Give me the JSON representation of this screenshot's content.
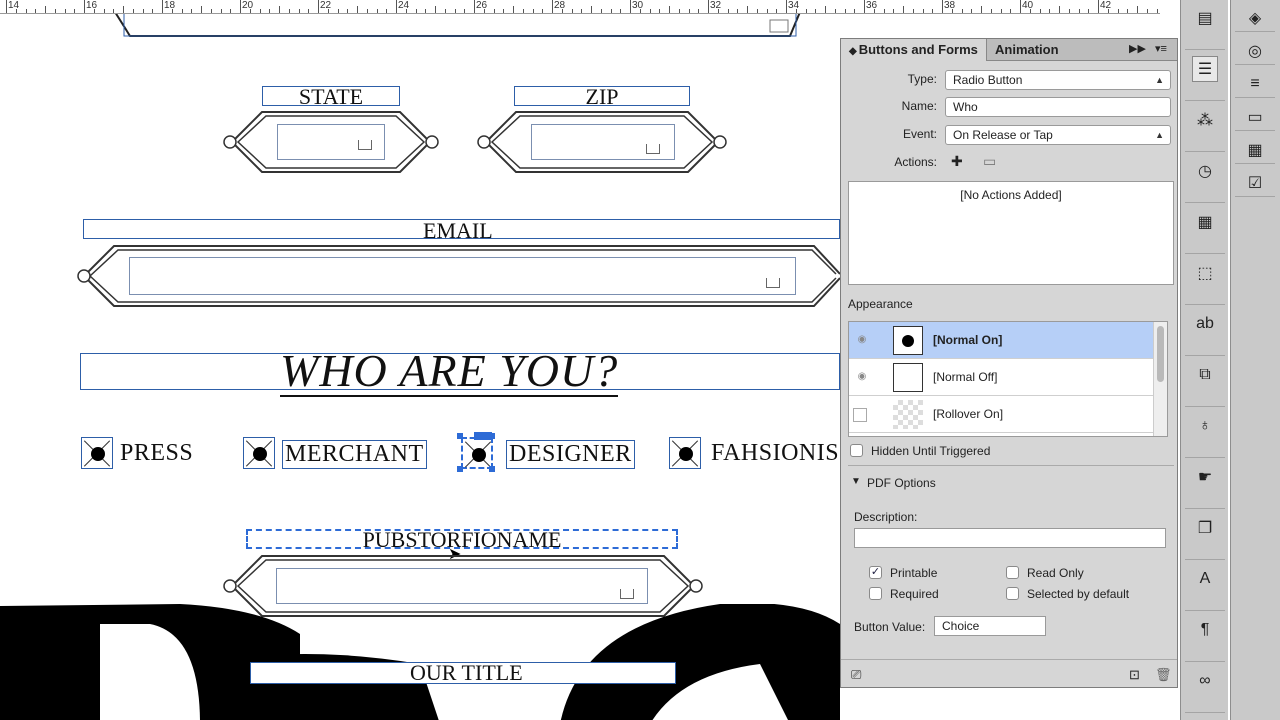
{
  "ruler": {
    "labels": [
      "14",
      "16",
      "18",
      "20",
      "22",
      "24",
      "26",
      "28",
      "30",
      "32",
      "34",
      "36",
      "38",
      "40",
      "42"
    ]
  },
  "doc": {
    "state_label": "STATE",
    "zip_label": "ZIP",
    "email_label": "EMAIL",
    "heading": "WHO ARE YOU?",
    "radios": [
      "PRESS",
      "MERCHANT",
      "DESIGNER",
      "FAHSIONIS"
    ],
    "overlap_label": "PUBSTORFIONAME",
    "title_label": "OUR TITLE"
  },
  "panel": {
    "tab_active": "Buttons and Forms",
    "tab_other": "Animation",
    "type_label": "Type:",
    "type_value": "Radio Button",
    "name_label": "Name:",
    "name_value": "Who",
    "event_label": "Event:",
    "event_value": "On Release or Tap",
    "actions_label": "Actions:",
    "actions_empty": "[No Actions Added]",
    "appearance_label": "Appearance",
    "states": [
      "[Normal On]",
      "[Normal Off]",
      "[Rollover On]"
    ],
    "hidden_until": "Hidden Until Triggered",
    "pdf_options": "PDF Options",
    "description_label": "Description:",
    "description_value": "",
    "printable": "Printable",
    "read_only": "Read Only",
    "required": "Required",
    "selected_default": "Selected by default",
    "button_value_label": "Button Value:",
    "button_value": "Choice"
  },
  "colors": {
    "selection_blue": "#2d6bd6",
    "state_highlight": "#b6cff7",
    "frame_blue": "#2d5ea8"
  },
  "icons": {
    "dock1": [
      "pages-icon",
      "buttons-forms-icon",
      "object-states-icon",
      "timing-icon",
      "media-icon",
      "layers-transform-icon",
      "spelling-icon",
      "hyperlinks-icon",
      "tips-icon",
      "touch-icon",
      "pages-stack-icon",
      "character-styles-icon",
      "paragraph-icon",
      "links-icon"
    ],
    "dock2": [
      "layers-icon",
      "swatches-icon",
      "stroke-icon",
      "gradient-icon",
      "table-icon",
      "checklist-icon"
    ]
  }
}
